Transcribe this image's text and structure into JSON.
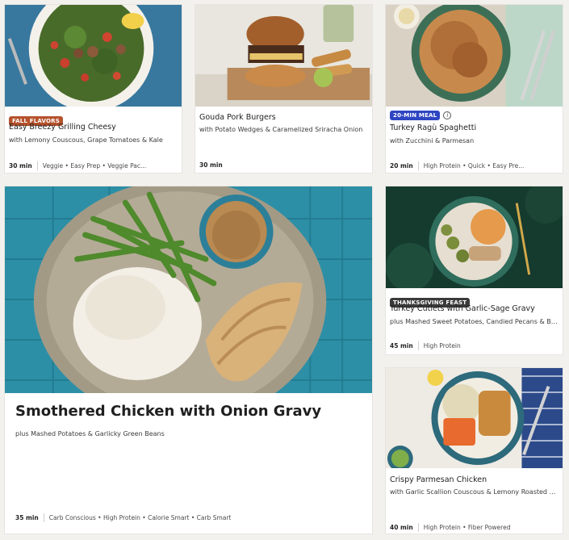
{
  "cards": [
    {
      "badge": "FALL FLAVORS",
      "badge_color": "#b5522c",
      "title": "Easy Breezy Grilling Cheesy",
      "subtitle": "with Lemony Couscous, Grape Tomatoes & Kale",
      "time": "30 min",
      "tags": "Veggie • Easy Prep • Veggie Pac..."
    },
    {
      "title": "Gouda Pork Burgers",
      "subtitle": "with Potato Wedges & Caramelized Sriracha Onion",
      "time": "30 min"
    },
    {
      "badge": "20-MIN MEAL",
      "badge_color": "#2f46c2",
      "title": "Turkey Ragù Spaghetti",
      "subtitle": "with Zucchini & Parmesan",
      "time": "20 min",
      "tags": "High Protein • Quick • Easy Pre..."
    },
    {
      "title": "Smothered Chicken with Onion Gravy",
      "subtitle": "plus Mashed Potatoes & Garlicky Green Beans",
      "time": "35 min",
      "tags": "Carb Conscious • High Protein • Calorie Smart • Carb Smart"
    },
    {
      "badge": "THANKSGIVING FEAST",
      "badge_color": "#3a3a3a",
      "title": "Turkey Cutlets with Garlic-Sage Gravy",
      "subtitle": "plus Mashed Sweet Potatoes, Candied Pecans & Bru...",
      "time": "45 min",
      "tags": "High Protein"
    },
    {
      "title": "Crispy Parmesan Chicken",
      "subtitle": "with Garlic Scallion Couscous & Lemony Roasted Ca...",
      "time": "40 min",
      "tags": "High Protein • Fiber Powered"
    }
  ]
}
